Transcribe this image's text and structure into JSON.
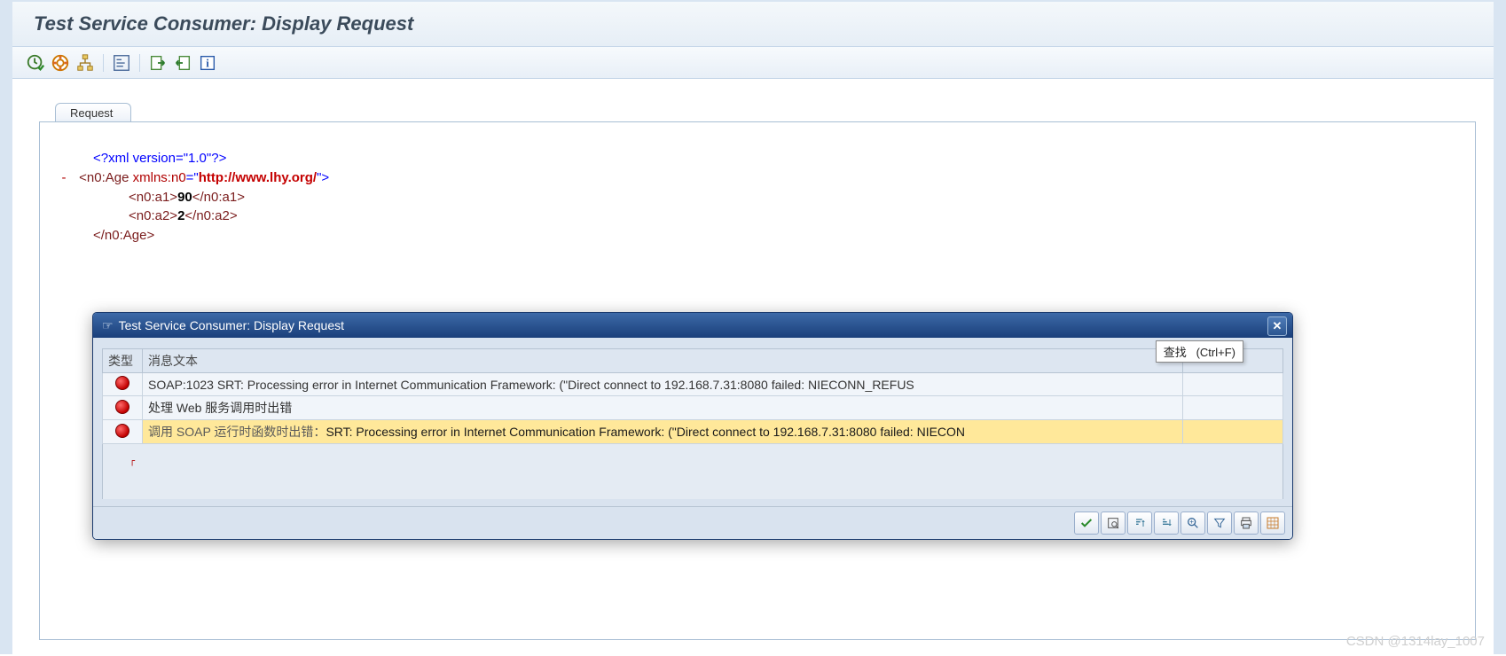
{
  "page_title": "Test Service Consumer: Display Request",
  "toolbar": {
    "b1": "clock-check",
    "b2": "lifebuoy",
    "b3": "hierarchy",
    "b4": "pretty-print",
    "b5": "export",
    "b6": "import",
    "b7": "info"
  },
  "tabs": {
    "request_label": "Request"
  },
  "xml": {
    "decl_open": "<?xml version=",
    "decl_ver": "\"1.0\"",
    "decl_close": "?>",
    "root_open1": "<n0:Age ",
    "root_attrname": "xmlns:n0",
    "root_eq": "=\"",
    "root_ns": "http://www.lhy.org/",
    "root_closeq": "\">",
    "a1_open": "<n0:a1>",
    "a1_val": "90",
    "a1_close": "</n0:a1>",
    "a2_open": "<n0:a2>",
    "a2_val": "2",
    "a2_close": "</n0:a2>",
    "root_end": "</n0:Age>"
  },
  "dialog": {
    "title": "Test Service Consumer: Display Request",
    "find_label": "查找",
    "find_shortcut": "(Ctrl+F)",
    "col_type": "类型",
    "col_msg": "消息文本",
    "rows": [
      {
        "text": "SOAP:1023 SRT: Processing error in Internet Communication Framework: (\"Direct connect to 192.168.7.31:8080 failed: NIECONN_REFUS",
        "highlight": false,
        "cjk": ""
      },
      {
        "text": "处理 Web 服务调用时出错",
        "highlight": false,
        "cjk": ""
      },
      {
        "text": "SRT: Processing error in Internet Communication Framework: (\"Direct connect to 192.168.7.31:8080 failed: NIECON",
        "highlight": true,
        "cjk": "调用 SOAP 运行时函数时出错："
      }
    ],
    "buttons": {
      "ok": "ok",
      "details": "details",
      "sort_asc": "sort-asc",
      "sort_desc": "sort-desc",
      "find": "find",
      "filter": "filter",
      "print": "print",
      "layout": "layout"
    }
  },
  "watermark": "CSDN @1314lay_1007"
}
